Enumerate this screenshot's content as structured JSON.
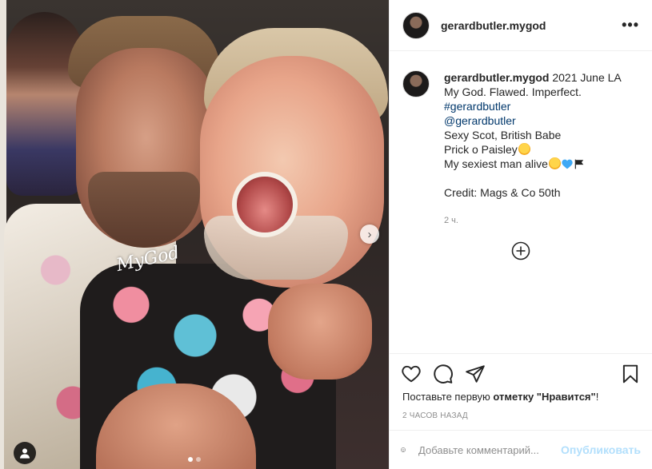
{
  "post": {
    "username": "gerardbutler.mygod",
    "watermark": "MyGod",
    "caption": {
      "lines": [
        "2021 June LA",
        "My God. Flawed. Imperfect.",
        "#gerardbutler",
        "@gerardbutler",
        "Sexy Scot, British Babe",
        "Prick o Paisley",
        "My sexiest man alive",
        "Credit: Mags & Co 50th"
      ]
    },
    "time_ago": "2 ч.",
    "likes_prompt_prefix": "Поставьте первую ",
    "likes_prompt_bold": "отметку \"Нравится\"",
    "likes_prompt_suffix": "!",
    "date": "2 ЧАСОВ НАЗАД"
  },
  "comment": {
    "placeholder": "Добавьте комментарий...",
    "publish_label": "Опубликовать"
  },
  "icons": {
    "more": "more-options-icon",
    "like": "heart-icon",
    "comment": "comment-icon",
    "share": "share-icon",
    "save": "bookmark-icon",
    "emoji": "emoji-icon",
    "load_more": "plus-circle-icon",
    "next": "chevron-right-icon",
    "user_tag": "user-tag-icon"
  },
  "colors": {
    "hashtag": "#00376b",
    "secondary_text": "#8e8e8e",
    "publish_disabled": "#b2dffc"
  },
  "carousel": {
    "count": 2,
    "active": 1
  }
}
